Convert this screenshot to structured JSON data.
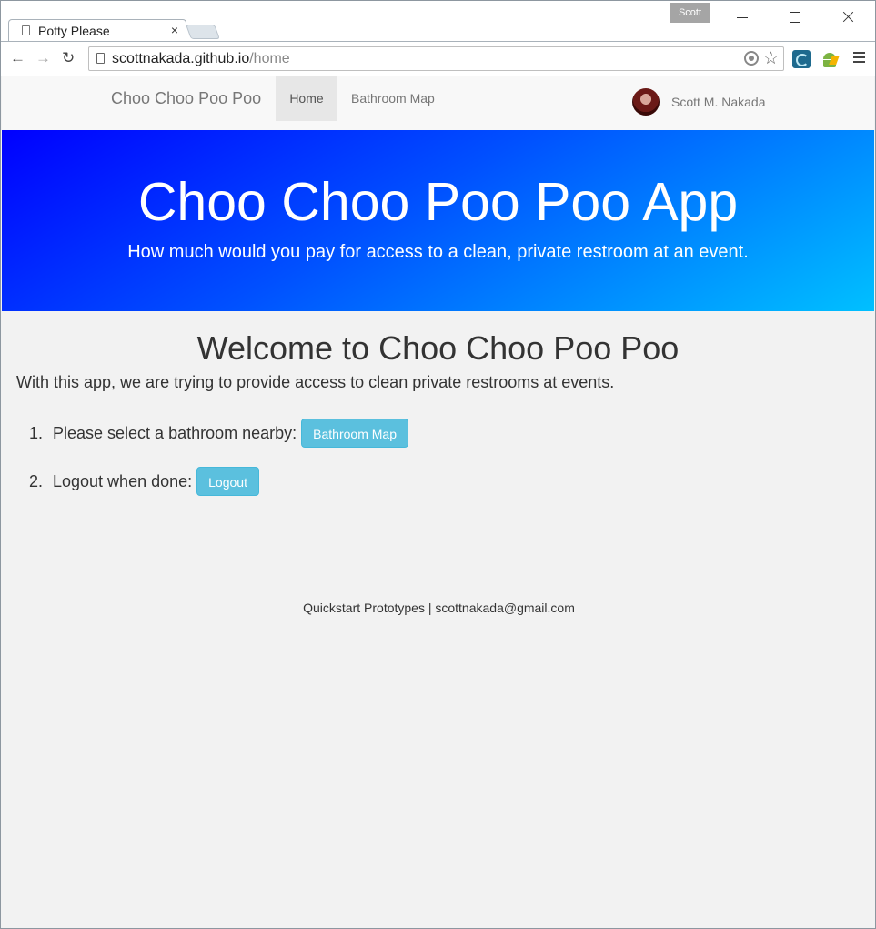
{
  "browser": {
    "tab_title": "Potty Please",
    "tab_close": "×",
    "profile_name": "Scott",
    "url_host": "scottnakada.github.io",
    "url_path": "/home",
    "back_glyph": "←",
    "forward_glyph": "→",
    "reload_glyph": "↻",
    "star_glyph": "☆",
    "extension_icons": [
      "cooliris-icon",
      "android-icon"
    ]
  },
  "navbar": {
    "brand": "Choo Choo Poo Poo",
    "links": [
      {
        "label": "Home",
        "active": true
      },
      {
        "label": "Bathroom Map",
        "active": false
      }
    ],
    "user_name": "Scott M. Nakada"
  },
  "hero": {
    "title": "Choo Choo Poo Poo App",
    "subtitle": "How much would you pay for access to a clean, private restroom at an event."
  },
  "main": {
    "heading": "Welcome to Choo Choo Poo Poo",
    "intro": "With this app, we are trying to provide access to clean private restrooms at events.",
    "steps": [
      {
        "number": "1.",
        "text": "Please select a bathroom nearby:",
        "button": "Bathroom Map"
      },
      {
        "number": "2.",
        "text": "Logout when done:",
        "button": "Logout"
      }
    ]
  },
  "footer": {
    "text": "Quickstart Prototypes | scottnakada@gmail.com"
  },
  "colors": {
    "hero_start": "#0000ff",
    "hero_end": "#00c0ff",
    "button_info": "#5bc0de",
    "navbar_bg": "#f8f8f8",
    "page_bg": "#f2f2f2"
  }
}
